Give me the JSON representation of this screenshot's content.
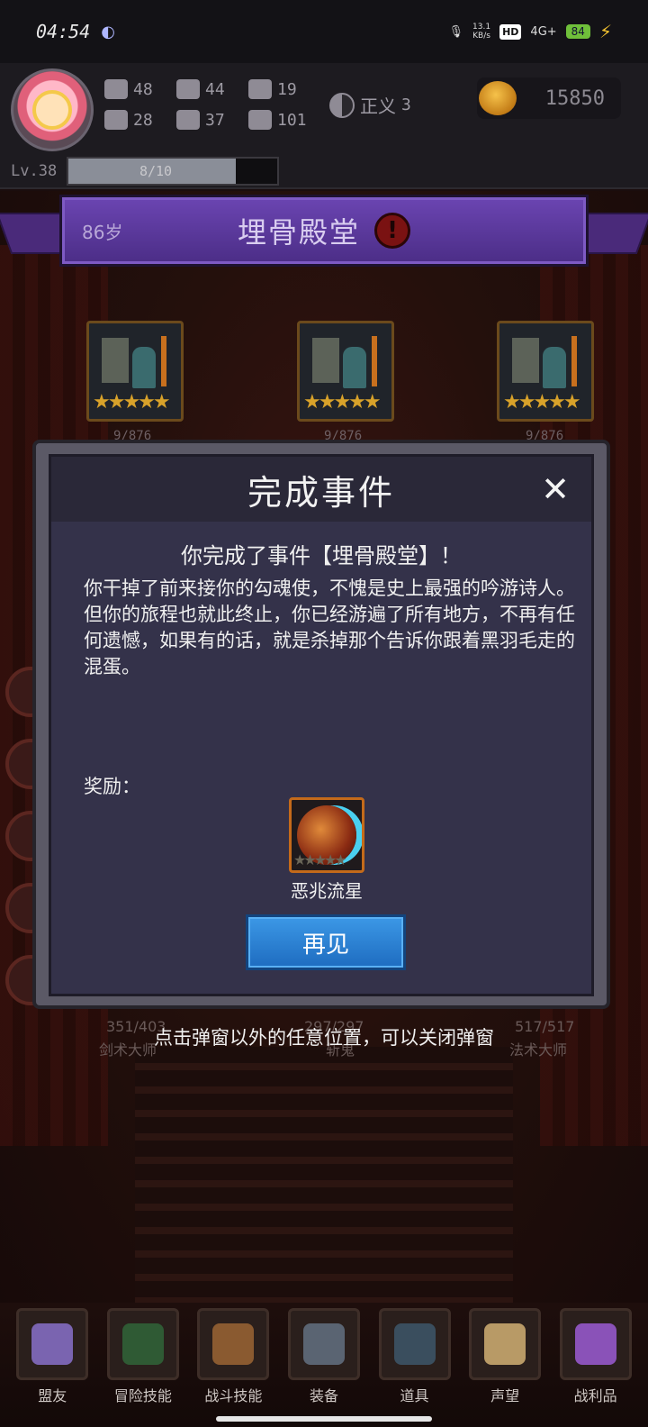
{
  "status_bar": {
    "time": "04:54",
    "net_speed_top": "13.1",
    "net_speed_bottom": "KB/s",
    "hd": "HD",
    "network": "4G+",
    "battery": "84"
  },
  "player": {
    "stats": [
      {
        "icon": "fist-icon",
        "value": "48"
      },
      {
        "icon": "boot-icon",
        "value": "44"
      },
      {
        "icon": "wizard-hat-icon",
        "value": "19"
      },
      {
        "icon": "clover-icon",
        "value": "28"
      },
      {
        "icon": "armor-icon",
        "value": "37"
      },
      {
        "icon": "wings-icon",
        "value": "101"
      }
    ],
    "alignment_label": "正义",
    "alignment_value": "3",
    "coins": "15850",
    "level": "Lv.38",
    "xp_text": "8/10",
    "xp_progress": 0.8
  },
  "location": {
    "age": "86岁",
    "title": "埋骨殿堂"
  },
  "cards": [
    {
      "count": "9/876"
    },
    {
      "count": "9/876"
    },
    {
      "count": "9/876"
    }
  ],
  "modal": {
    "title": "完成事件",
    "subtitle": "你完成了事件【埋骨殿堂】！",
    "body": "你干掉了前来接你的勾魂使，不愧是史上最强的吟游诗人。但你的旅程也就此终止，你已经游遍了所有地方，不再有任何遗憾，如果有的话，就是杀掉那个告诉你跟着黑羽毛走的混蛋。",
    "reward_label": "奖励：",
    "reward_name": "恶兆流星",
    "confirm_label": "再见"
  },
  "hint": "点击弹窗以外的任意位置，可以关闭弹窗",
  "partial_labels": {
    "left_count": "351/403",
    "left_name": "剑术大师",
    "middle_count": "297/297",
    "middle_name": "斩鬼",
    "right_count": "517/517",
    "right_name": "法术大师"
  },
  "nav": [
    {
      "label": "盟友",
      "icon": "scroll-icon",
      "color": "#7a64b0"
    },
    {
      "label": "冒险技能",
      "icon": "book-icon",
      "color": "#2f5a34"
    },
    {
      "label": "战斗技能",
      "icon": "backpack-icon",
      "color": "#8a5a30"
    },
    {
      "label": "装备",
      "icon": "swords-icon",
      "color": "#5a6472"
    },
    {
      "label": "道具",
      "icon": "pouch-icon",
      "color": "#3a4e5e"
    },
    {
      "label": "声望",
      "icon": "parchment-icon",
      "color": "#b89a66"
    },
    {
      "label": "战利品",
      "icon": "chest-icon",
      "color": "#8a52b8"
    }
  ]
}
